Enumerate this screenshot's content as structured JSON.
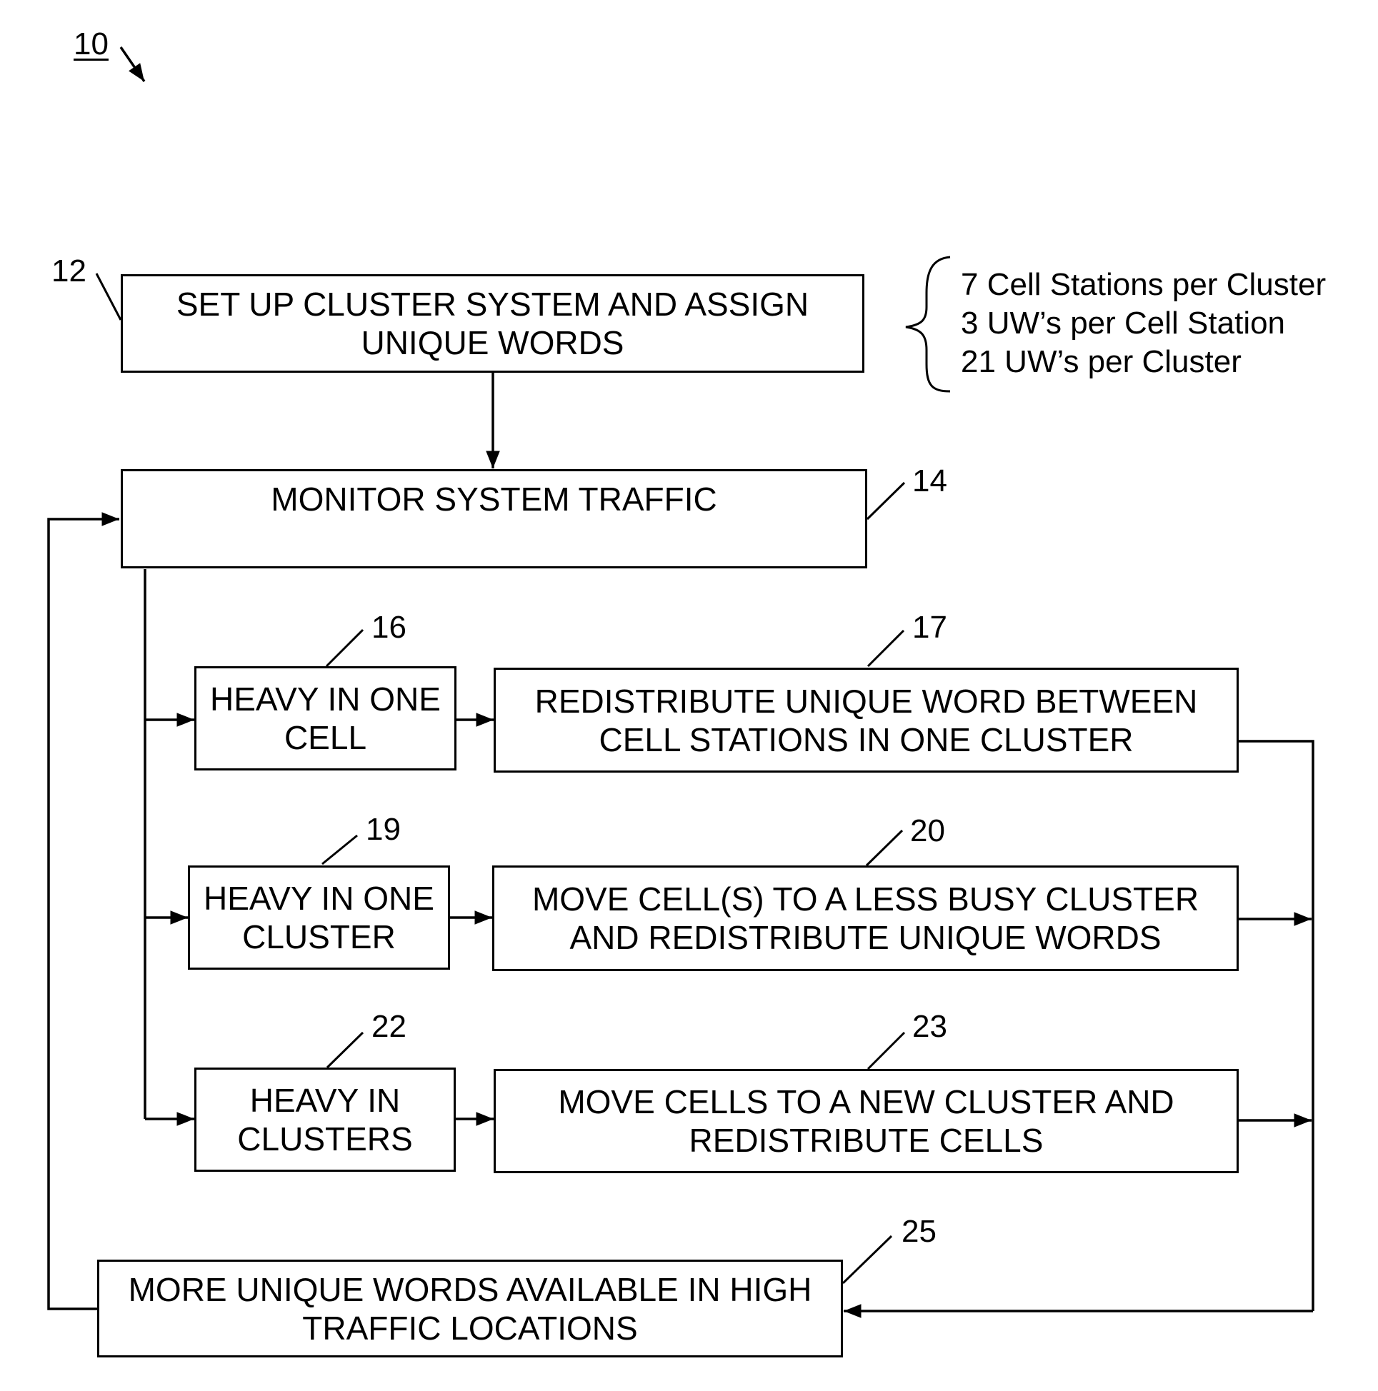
{
  "figure": {
    "reference": "10",
    "annotation_lines": [
      "7 Cell Stations per Cluster",
      "3 UW’s per Cell Station",
      "21 UW’s per Cluster"
    ]
  },
  "steps": {
    "s12": {
      "ref": "12",
      "text": "SET UP CLUSTER SYSTEM AND ASSIGN\nUNIQUE WORDS"
    },
    "s14": {
      "ref": "14",
      "text": "MONITOR SYSTEM TRAFFIC"
    },
    "s16": {
      "ref": "16",
      "text": "HEAVY IN ONE\nCELL"
    },
    "s17": {
      "ref": "17",
      "text": "REDISTRIBUTE UNIQUE WORD BETWEEN\nCELL STATIONS IN ONE CLUSTER"
    },
    "s19": {
      "ref": "19",
      "text": "HEAVY IN ONE\nCLUSTER"
    },
    "s20": {
      "ref": "20",
      "text": "MOVE CELL(S) TO A LESS BUSY CLUSTER\nAND REDISTRIBUTE UNIQUE WORDS"
    },
    "s22": {
      "ref": "22",
      "text": "HEAVY IN\nCLUSTERS"
    },
    "s23": {
      "ref": "23",
      "text": "MOVE CELLS TO A NEW CLUSTER AND\nREDISTRIBUTE CELLS"
    },
    "s25": {
      "ref": "25",
      "text": "MORE UNIQUE WORDS AVAILABLE IN HIGH\nTRAFFIC LOCATIONS"
    }
  },
  "colors": {
    "ink": "#000000",
    "background": "#ffffff"
  }
}
